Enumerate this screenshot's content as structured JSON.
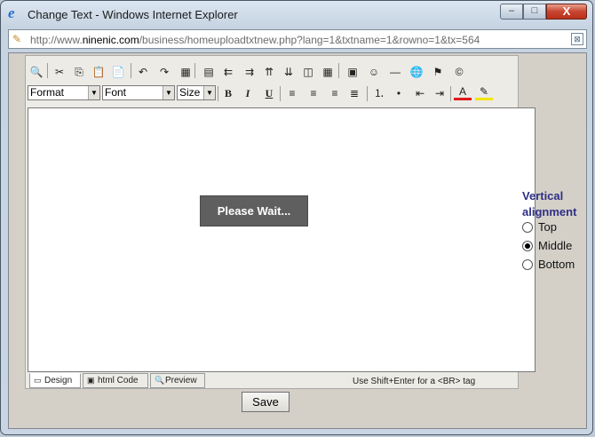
{
  "window": {
    "title": "Change Text - Windows Internet Explorer",
    "icon": "ie-icon",
    "controls": {
      "minimize": "–",
      "maximize": "□",
      "close": "X"
    }
  },
  "address_bar": {
    "url_prefix": "http://www.",
    "url_domain": "ninenic.com",
    "url_rest": "/business/homeuploadtxtnew.php?lang=1&txtname=1&rowno=1&tx=564"
  },
  "toolbar": {
    "row1": [
      {
        "name": "find-icon",
        "glyph": "🔍"
      },
      {
        "name": "cut-icon",
        "glyph": "✂"
      },
      {
        "name": "copy-icon",
        "glyph": "⎘"
      },
      {
        "name": "paste-icon",
        "glyph": "📋"
      },
      {
        "name": "paste-word-icon",
        "glyph": "📄"
      },
      {
        "name": "undo-icon",
        "glyph": "↶"
      },
      {
        "name": "redo-icon",
        "glyph": "↷"
      },
      {
        "name": "insert-table-icon",
        "glyph": "▦"
      },
      {
        "name": "table-properties-icon",
        "glyph": "▤"
      },
      {
        "name": "insert-column-left-icon",
        "glyph": "⇇"
      },
      {
        "name": "insert-column-right-icon",
        "glyph": "⇉"
      },
      {
        "name": "insert-row-above-icon",
        "glyph": "⇈"
      },
      {
        "name": "insert-row-below-icon",
        "glyph": "⇊"
      },
      {
        "name": "merge-cells-icon",
        "glyph": "◫"
      },
      {
        "name": "split-cells-icon",
        "glyph": "▦"
      },
      {
        "name": "insert-image-icon",
        "glyph": "▣"
      },
      {
        "name": "smiley-icon",
        "glyph": "☺"
      },
      {
        "name": "horizontal-rule-icon",
        "glyph": "—"
      },
      {
        "name": "hyperlink-icon",
        "glyph": "🌐"
      },
      {
        "name": "anchor-icon",
        "glyph": "⚑"
      },
      {
        "name": "special-char-icon",
        "glyph": "©"
      }
    ],
    "format_select": "Format",
    "font_select": "Font",
    "size_select": "Size",
    "row2": [
      {
        "name": "bold-icon",
        "glyph": "B"
      },
      {
        "name": "italic-icon",
        "glyph": "I"
      },
      {
        "name": "underline-icon",
        "glyph": "U"
      },
      {
        "name": "align-left-icon",
        "glyph": "≡"
      },
      {
        "name": "align-center-icon",
        "glyph": "≡"
      },
      {
        "name": "align-right-icon",
        "glyph": "≡"
      },
      {
        "name": "justify-icon",
        "glyph": "≣"
      },
      {
        "name": "ordered-list-icon",
        "glyph": "⒈"
      },
      {
        "name": "unordered-list-icon",
        "glyph": "•"
      },
      {
        "name": "outdent-icon",
        "glyph": "⇤"
      },
      {
        "name": "indent-icon",
        "glyph": "⇥"
      },
      {
        "name": "font-color-icon",
        "glyph": "A"
      },
      {
        "name": "highlight-icon",
        "glyph": "✎"
      }
    ]
  },
  "editor": {
    "loading_text": "Please Wait...",
    "tabs": [
      {
        "label": "Design",
        "icon": "design-icon",
        "glyph": "▭"
      },
      {
        "label": "html Code",
        "icon": "html-code-icon",
        "glyph": "▣"
      },
      {
        "label": "Preview",
        "icon": "preview-icon",
        "glyph": "🔍"
      }
    ],
    "hint": "Use Shift+Enter for a <BR> tag"
  },
  "vertical_alignment": {
    "title_line1": "Vertical",
    "title_line2": "alignment",
    "options": [
      {
        "label": "Top",
        "checked": false
      },
      {
        "label": "Middle",
        "checked": true
      },
      {
        "label": "Bottom",
        "checked": false
      }
    ]
  },
  "save_label": "Save"
}
